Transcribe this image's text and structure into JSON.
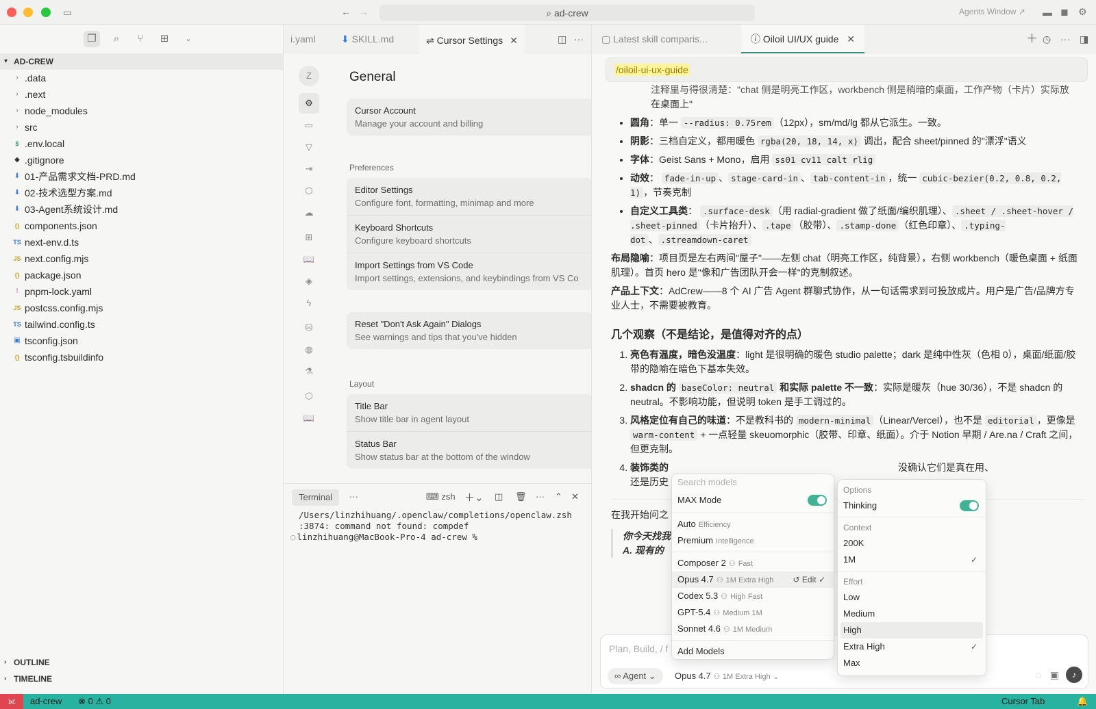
{
  "window": {
    "search_text": "ad-crew",
    "agents_window": "Agents Window ↗"
  },
  "sidebar": {
    "explorer_title": "AD-CREW",
    "items": [
      {
        "name": ".data",
        "type": "folder",
        "icon": "chevron-right-icon"
      },
      {
        "name": ".next",
        "type": "folder",
        "icon": "chevron-right-icon"
      },
      {
        "name": "node_modules",
        "type": "folder",
        "icon": "chevron-right-icon"
      },
      {
        "name": "src",
        "type": "folder",
        "icon": "chevron-right-icon"
      },
      {
        "name": ".env.local",
        "type": "file",
        "icon": "dollar-icon"
      },
      {
        "name": ".gitignore",
        "type": "file",
        "icon": "git-icon"
      },
      {
        "name": "01-产品需求文档-PRD.md",
        "type": "file",
        "icon": "markdown-icon"
      },
      {
        "name": "02-技术选型方案.md",
        "type": "file",
        "icon": "markdown-icon"
      },
      {
        "name": "03-Agent系统设计.md",
        "type": "file",
        "icon": "markdown-icon"
      },
      {
        "name": "components.json",
        "type": "file",
        "icon": "json-icon"
      },
      {
        "name": "next-env.d.ts",
        "type": "file",
        "icon": "typescript-icon"
      },
      {
        "name": "next.config.mjs",
        "type": "file",
        "icon": "javascript-icon"
      },
      {
        "name": "package.json",
        "type": "file",
        "icon": "json-icon"
      },
      {
        "name": "pnpm-lock.yaml",
        "type": "file",
        "icon": "yaml-icon"
      },
      {
        "name": "postcss.config.mjs",
        "type": "file",
        "icon": "javascript-icon"
      },
      {
        "name": "tailwind.config.ts",
        "type": "file",
        "icon": "typescript-icon"
      },
      {
        "name": "tsconfig.json",
        "type": "file",
        "icon": "tsconfig-icon"
      },
      {
        "name": "tsconfig.tsbuildinfo",
        "type": "file",
        "icon": "json-icon"
      }
    ],
    "outline": "OUTLINE",
    "timeline": "TIMELINE"
  },
  "editor": {
    "tabs": [
      {
        "label": "i.yaml"
      },
      {
        "label": "SKILL.md"
      },
      {
        "label": "Cursor Settings"
      }
    ]
  },
  "settings": {
    "title": "General",
    "avatar_letter": "Z",
    "account": {
      "title": "Cursor Account",
      "desc": "Manage your account and billing"
    },
    "preferences_label": "Preferences",
    "preferences": [
      {
        "title": "Editor Settings",
        "desc": "Configure font, formatting, minimap and more"
      },
      {
        "title": "Keyboard Shortcuts",
        "desc": "Configure keyboard shortcuts"
      },
      {
        "title": "Import Settings from VS Code",
        "desc": "Import settings, extensions, and keybindings from VS Co"
      }
    ],
    "reset": {
      "title": "Reset \"Don't Ask Again\" Dialogs",
      "desc": "See warnings and tips that you've hidden"
    },
    "layout_label": "Layout",
    "layout": [
      {
        "title": "Title Bar",
        "desc": "Show title bar in agent layout"
      },
      {
        "title": "Status Bar",
        "desc": "Show status bar at the bottom of the window"
      }
    ]
  },
  "terminal": {
    "tab": "Terminal",
    "shell": "zsh",
    "lines": [
      "/Users/linzhihuang/.openclaw/completions/openclaw.zsh",
      ":3874: command not found: compdef",
      "linzhihuang@MacBook-Pro-4 ad-crew %"
    ]
  },
  "right_panel": {
    "tabs": [
      {
        "label": "Latest skill comparis..."
      },
      {
        "label": "Oiloil UI/UX guide"
      }
    ],
    "slash_command": "/oiloil-ui-ux-guide",
    "top_cut": "注释里与得很清楚：\"chat 侧是明亮工作区，workbench 侧是稍暗的桌面，工作产物（卡片）实际放",
    "top_cut2": "在桌面上\"",
    "bullets": [
      {
        "b": "圆角",
        "t1": "：单一 ",
        "c1": "--radius: 0.75rem",
        "t2": "（12px），sm/md/lg 都从它派生。一致。"
      },
      {
        "b": "阴影",
        "t1": "：三档自定义，都用暖色 ",
        "c1": "rgba(20, 18, 14, x)",
        "t2": " 调出，配合 sheet/pinned 的\"漂浮\"语义"
      },
      {
        "b": "字体",
        "t1": "：Geist Sans + Mono，启用 ",
        "c1": "ss01 cv11 calt rlig",
        "t2": ""
      }
    ],
    "anim_label": "动效",
    "anim_c1": "fade-in-up",
    "anim_c2": "stage-card-in",
    "anim_c3": "tab-content-in",
    "anim_t": "，统一",
    "anim_c4": "cubic-bezier(0.2, 0.8, 0.2, 1)",
    "anim_end": "，节奏克制",
    "tool_label": "自定义工具类",
    "tool_c1": ".surface-desk",
    "tool_t1": "（用 radial-gradient 做了纸面/编织肌理）、",
    "tool_c2": ".sheet / .sheet-hover / .sheet-pinned",
    "tool_t2": "（卡片抬升）、",
    "tool_c3": ".tape",
    "tool_t3": "（胶带）、",
    "tool_c4": ".stamp-done",
    "tool_t4": "（红色印章）、",
    "tool_c5": ".typing-dot",
    "tool_t5": "、",
    "tool_c6": ".streamdown-caret",
    "layout_p_b": "布局隐喻",
    "layout_p": "：项目页是左右两间\"屋子\"——左侧 chat（明亮工作区，纯背景），右侧 workbench（暖色桌面 + 纸面肌理）。首页 hero 是\"像和广告团队开会一样\"的克制叙述。",
    "context_p_b": "产品上下文",
    "context_p": "：AdCrew——8 个 AI 广告 Agent 群聊式协作，从一句话需求到可投放成片。用户是广告/品牌方专业人士，不需要被教育。",
    "h3": "几个观察（不是结论，是值得对齐的点）",
    "obs1_b": "亮色有温度，暗色没温度",
    "obs1": "：light 是很明确的暖色 studio palette；dark 是纯中性灰（色相 0），桌面/纸面/胶带的隐喻在暗色下基本失效。",
    "obs2_b1": "shadcn 的 ",
    "obs2_c": "baseColor: neutral",
    "obs2_b2": " 和实际 palette 不一致",
    "obs2": "：实际是暖灰（hue 30/36），不是 shadcn 的 neutral。不影响功能，但说明 token 是手工调过的。",
    "obs3_b": "风格定位有自己的味道",
    "obs3_t1": "：不是教科书的 ",
    "obs3_c1": "modern-minimal",
    "obs3_t2": "（Linear/Vercel），也不是 ",
    "obs3_c2": "editorial",
    "obs3_t3": "，更像是 ",
    "obs3_c3": "warm-content",
    "obs3_t4": " + 一点轻量 skeuomorphic（胶带、印章、纸面）。介于 Notion 早期 / Are.na / Craft 之间，但更克制。",
    "obs4_b": "装饰类的",
    "obs4_tail": "没确认它们是真在用、",
    "obs4_line2": "还是历史",
    "start_p": "在我开始问之",
    "quote1": "你今天找我",
    "quote2": "A. 现有的"
  },
  "composer": {
    "placeholder": "Plan, Build, / f",
    "agent_label": "Agent",
    "model_name": "Opus 4.7",
    "model_sub": "1M Extra High"
  },
  "model_menu": {
    "search_placeholder": "Search models",
    "max_mode": "MAX Mode",
    "items_a": [
      {
        "name": "Auto",
        "sub": "Efficiency"
      },
      {
        "name": "Premium",
        "sub": "Intelligence"
      }
    ],
    "items_b": [
      {
        "name": "Composer 2",
        "sub": "Fast"
      },
      {
        "name": "Opus 4.7",
        "sub": "1M Extra High",
        "edit": "Edit"
      },
      {
        "name": "Codex 5.3",
        "sub": "High Fast"
      },
      {
        "name": "GPT-5.4",
        "sub": "Medium 1M"
      },
      {
        "name": "Sonnet 4.6",
        "sub": "1M Medium"
      }
    ],
    "add_models": "Add Models"
  },
  "options_menu": {
    "options_label": "Options",
    "thinking": "Thinking",
    "context_label": "Context",
    "context": [
      "200K",
      "1M"
    ],
    "context_selected": "1M",
    "effort_label": "Effort",
    "effort": [
      "Low",
      "Medium",
      "High",
      "Extra High",
      "Max"
    ],
    "effort_selected": "Extra High",
    "effort_hover": "High"
  },
  "statusbar": {
    "project": "ad-crew",
    "errors": "0",
    "warnings": "0",
    "right": "Cursor Tab"
  },
  "colors": {
    "accent": "#27b3a0",
    "remote": "#e0464f",
    "toggle": "#3fb393",
    "highlight": "#fff59d"
  }
}
